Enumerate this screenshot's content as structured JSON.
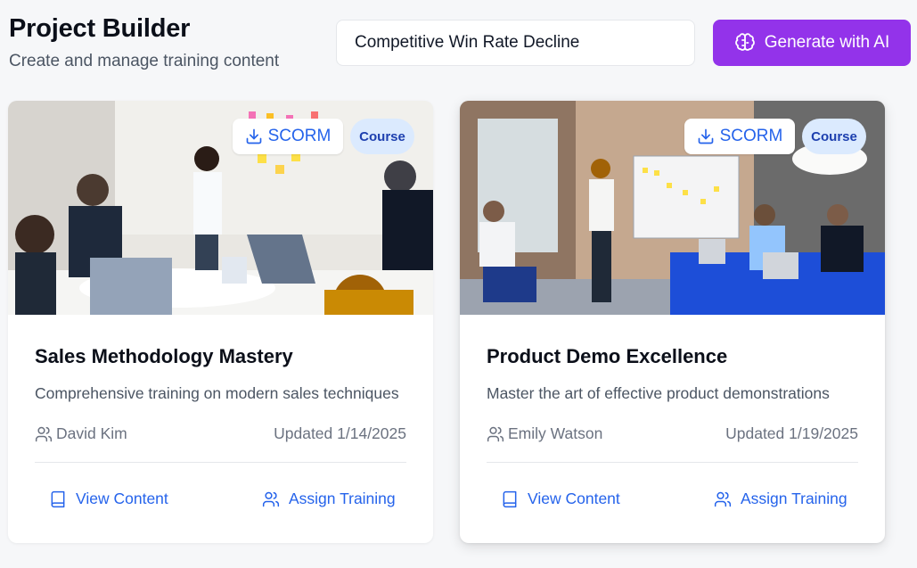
{
  "header": {
    "title": "Project Builder",
    "subtitle": "Create and manage training content",
    "search_value": "Competitive Win Rate Decline",
    "generate_label": "Generate with AI",
    "generate_icon": "brain-icon",
    "accent_color": "#9333ea"
  },
  "cards": [
    {
      "image": "photo-team-meeting-sticky-notes",
      "scorm_label": "SCORM",
      "scorm_icon": "download-icon",
      "badge": "Course",
      "title": "Sales Methodology Mastery",
      "description": "Comprehensive training on modern sales techniques",
      "author": "David Kim",
      "author_icon": "users-icon",
      "updated": "Updated 1/14/2025",
      "view_label": "View Content",
      "view_icon": "book-icon",
      "assign_label": "Assign Training",
      "assign_icon": "users-icon"
    },
    {
      "image": "photo-office-whiteboard-presentation",
      "scorm_label": "SCORM",
      "scorm_icon": "download-icon",
      "badge": "Course",
      "title": "Product Demo Excellence",
      "description": "Master the art of effective product demonstrations",
      "author": "Emily Watson",
      "author_icon": "users-icon",
      "updated": "Updated 1/19/2025",
      "view_label": "View Content",
      "view_icon": "book-icon",
      "assign_label": "Assign Training",
      "assign_icon": "users-icon"
    }
  ]
}
